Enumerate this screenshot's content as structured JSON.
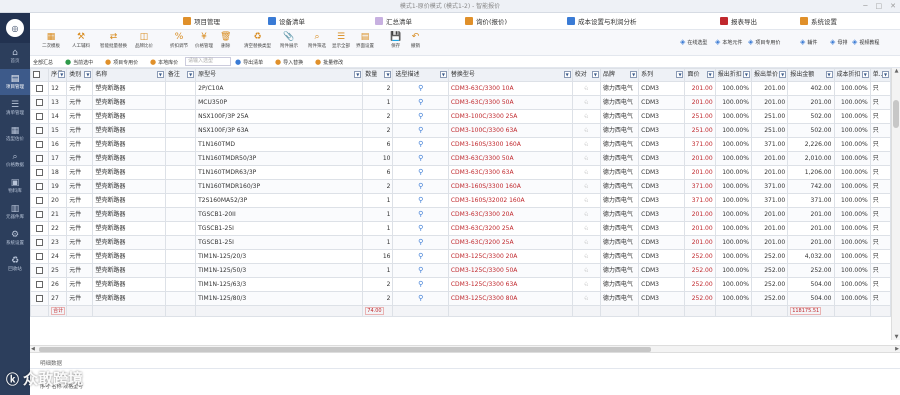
{
  "window": {
    "title": "模式1-原价模式 (模式1-2) - 智能报价"
  },
  "sidebar": {
    "logo": "◎",
    "items": [
      {
        "label": "首页",
        "icon": "home-icon",
        "glyph": "⌂"
      },
      {
        "label": "项目管理",
        "icon": "folder-icon",
        "glyph": "▤"
      },
      {
        "label": "清单管理",
        "icon": "list-icon",
        "glyph": "☰"
      },
      {
        "label": "选型估价",
        "icon": "calculator-icon",
        "glyph": "▦"
      },
      {
        "label": "价格数据",
        "icon": "search-icon",
        "glyph": "⌕"
      },
      {
        "label": "物料库",
        "icon": "box-icon",
        "glyph": "▣"
      },
      {
        "label": "元器件库",
        "icon": "chip-icon",
        "glyph": "▥"
      },
      {
        "label": "系统设置",
        "icon": "settings-icon",
        "glyph": "⚙"
      },
      {
        "label": "回收站",
        "icon": "trash-icon",
        "glyph": "♻"
      }
    ],
    "active_index": 1
  },
  "top_menu": [
    {
      "label": "项目管理",
      "color": "#e0902a"
    },
    {
      "label": "设备清单",
      "color": "#3a7bd5"
    },
    {
      "label": "汇总清单",
      "color": "#c7b0e0"
    },
    {
      "label": "询价(报价)",
      "color": "#e0902a"
    },
    {
      "label": "成本设置与利润分析",
      "color": "#3a7bd5"
    },
    {
      "label": "报表导出",
      "color": "#c0282d"
    },
    {
      "label": "系统设置",
      "color": "#e0902a"
    }
  ],
  "toolbar": {
    "buttons": [
      "二次模板",
      "人工辅料",
      "智能批量替换",
      "品牌比价",
      "折扣调节",
      "价格管理",
      "删除",
      "清空替换类型",
      "附件展示",
      "附件筛选",
      "显示全部",
      "界面设置",
      "保存",
      "撤销"
    ],
    "right_buttons": [
      "在线选型",
      "本地元件",
      "项目专用价",
      "辅件",
      "母排",
      "视频教程"
    ]
  },
  "toolbar2": {
    "all_label": "全部汇总",
    "items": [
      "当前选中",
      "项目专用价",
      "本地库价",
      "导出清单",
      "导入替换",
      "批量修改"
    ],
    "filter_placeholder": "请输入选型"
  },
  "grid": {
    "columns": [
      "",
      "序号",
      "类别",
      "名称",
      "备注",
      "原型号",
      "数量",
      "选型描述",
      "替换型号",
      "校对",
      "品牌",
      "系列",
      "面价",
      "报出折扣",
      "报出单价",
      "报出金额",
      "成本折扣",
      "单..."
    ],
    "rows": [
      {
        "no": "12",
        "cat": "元件",
        "name": "塑壳断路器",
        "model": "2P/C10A",
        "qty": "2",
        "rep": "CDM3-63C/3300 10A",
        "brand": "德力西电气",
        "series": "CDM3",
        "price": "201.00",
        "disc": "100.00%",
        "unit": "201.00",
        "amount": "402.00",
        "cost": "100.00%",
        "u": "只"
      },
      {
        "no": "13",
        "cat": "元件",
        "name": "塑壳断路器",
        "model": "MCU350P",
        "qty": "1",
        "rep": "CDM3-63C/3300 50A",
        "brand": "德力西电气",
        "series": "CDM3",
        "price": "201.00",
        "disc": "100.00%",
        "unit": "201.00",
        "amount": "201.00",
        "cost": "100.00%",
        "u": "只"
      },
      {
        "no": "14",
        "cat": "元件",
        "name": "塑壳断路器",
        "model": "NSX100F/3P 25A",
        "qty": "2",
        "rep": "CDM3-100C/3300 25A",
        "brand": "德力西电气",
        "series": "CDM3",
        "price": "251.00",
        "disc": "100.00%",
        "unit": "251.00",
        "amount": "502.00",
        "cost": "100.00%",
        "u": "只"
      },
      {
        "no": "15",
        "cat": "元件",
        "name": "塑壳断路器",
        "model": "NSX100F/3P 63A",
        "qty": "2",
        "rep": "CDM3-100C/3300 63A",
        "brand": "德力西电气",
        "series": "CDM3",
        "price": "251.00",
        "disc": "100.00%",
        "unit": "251.00",
        "amount": "502.00",
        "cost": "100.00%",
        "u": "只"
      },
      {
        "no": "16",
        "cat": "元件",
        "name": "塑壳断路器",
        "model": "T1N160TMD",
        "qty": "6",
        "rep": "CDM3-160S/3300 160A",
        "brand": "德力西电气",
        "series": "CDM3",
        "price": "371.00",
        "disc": "100.00%",
        "unit": "371.00",
        "amount": "2,226.00",
        "cost": "100.00%",
        "u": "只"
      },
      {
        "no": "17",
        "cat": "元件",
        "name": "塑壳断路器",
        "model": "T1N160TMDR50/3P",
        "qty": "10",
        "rep": "CDM3-63C/3300 50A",
        "brand": "德力西电气",
        "series": "CDM3",
        "price": "201.00",
        "disc": "100.00%",
        "unit": "201.00",
        "amount": "2,010.00",
        "cost": "100.00%",
        "u": "只"
      },
      {
        "no": "18",
        "cat": "元件",
        "name": "塑壳断路器",
        "model": "T1N160TMDR63/3P",
        "qty": "6",
        "rep": "CDM3-63C/3300 63A",
        "brand": "德力西电气",
        "series": "CDM3",
        "price": "201.00",
        "disc": "100.00%",
        "unit": "201.00",
        "amount": "1,206.00",
        "cost": "100.00%",
        "u": "只"
      },
      {
        "no": "19",
        "cat": "元件",
        "name": "塑壳断路器",
        "model": "T1N160TMDR160/3P",
        "qty": "2",
        "rep": "CDM3-160S/3300 160A",
        "brand": "德力西电气",
        "series": "CDM3",
        "price": "371.00",
        "disc": "100.00%",
        "unit": "371.00",
        "amount": "742.00",
        "cost": "100.00%",
        "u": "只"
      },
      {
        "no": "20",
        "cat": "元件",
        "name": "塑壳断路器",
        "model": "T2S160MA52/3P",
        "qty": "1",
        "rep": "CDM3-160S/32002 160A",
        "brand": "德力西电气",
        "series": "CDM3",
        "price": "371.00",
        "disc": "100.00%",
        "unit": "371.00",
        "amount": "371.00",
        "cost": "100.00%",
        "u": "只"
      },
      {
        "no": "21",
        "cat": "元件",
        "name": "塑壳断路器",
        "model": "TGSCB1-20II",
        "qty": "1",
        "rep": "CDM3-63C/3300 20A",
        "brand": "德力西电气",
        "series": "CDM3",
        "price": "201.00",
        "disc": "100.00%",
        "unit": "201.00",
        "amount": "201.00",
        "cost": "100.00%",
        "u": "只"
      },
      {
        "no": "22",
        "cat": "元件",
        "name": "塑壳断路器",
        "model": "TGSCB1-25I",
        "qty": "1",
        "rep": "CDM3-63C/3200 25A",
        "brand": "德力西电气",
        "series": "CDM3",
        "price": "201.00",
        "disc": "100.00%",
        "unit": "201.00",
        "amount": "201.00",
        "cost": "100.00%",
        "u": "只"
      },
      {
        "no": "23",
        "cat": "元件",
        "name": "塑壳断路器",
        "model": "TGSCB1-25I",
        "qty": "1",
        "rep": "CDM3-63C/3200 25A",
        "brand": "德力西电气",
        "series": "CDM3",
        "price": "201.00",
        "disc": "100.00%",
        "unit": "201.00",
        "amount": "201.00",
        "cost": "100.00%",
        "u": "只"
      },
      {
        "no": "24",
        "cat": "元件",
        "name": "塑壳断路器",
        "model": "TIM1N-125/20/3",
        "qty": "16",
        "rep": "CDM3-125C/3300 20A",
        "brand": "德力西电气",
        "series": "CDM3",
        "price": "252.00",
        "disc": "100.00%",
        "unit": "252.00",
        "amount": "4,032.00",
        "cost": "100.00%",
        "u": "只"
      },
      {
        "no": "25",
        "cat": "元件",
        "name": "塑壳断路器",
        "model": "TIM1N-125/50/3",
        "qty": "1",
        "rep": "CDM3-125C/3300 50A",
        "brand": "德力西电气",
        "series": "CDM3",
        "price": "252.00",
        "disc": "100.00%",
        "unit": "252.00",
        "amount": "252.00",
        "cost": "100.00%",
        "u": "只"
      },
      {
        "no": "26",
        "cat": "元件",
        "name": "塑壳断路器",
        "model": "TIM1N-125/63/3",
        "qty": "2",
        "rep": "CDM3-125C/3300 63A",
        "brand": "德力西电气",
        "series": "CDM3",
        "price": "252.00",
        "disc": "100.00%",
        "unit": "252.00",
        "amount": "504.00",
        "cost": "100.00%",
        "u": "只"
      },
      {
        "no": "27",
        "cat": "元件",
        "name": "塑壳断路器",
        "model": "TIM1N-125/80/3",
        "qty": "2",
        "rep": "CDM3-125C/3300 80A",
        "brand": "德力西电气",
        "series": "CDM3",
        "price": "252.00",
        "disc": "100.00%",
        "unit": "252.00",
        "amount": "504.00",
        "cost": "100.00%",
        "u": "只"
      }
    ],
    "summary": {
      "label": "合计",
      "qty": "74.00",
      "amount": "118175.51"
    }
  },
  "detail": {
    "title": "明细数据",
    "header": "序号  名称  规格型号"
  },
  "watermark": {
    "logo": "ⓚ",
    "text": "众敢跨境"
  },
  "colors": {
    "sidebar": "#2c3e5c",
    "accent": "#3a7bd5",
    "red": "#c0282d"
  }
}
